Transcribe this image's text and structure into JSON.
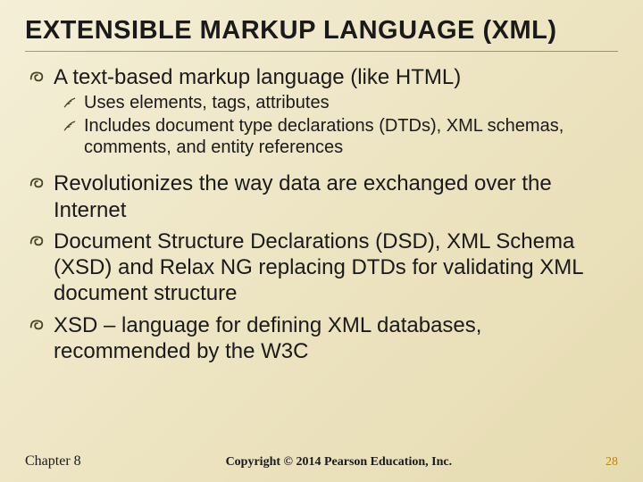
{
  "title": "EXTENSIBLE MARKUP LANGUAGE (XML)",
  "bullets": {
    "b1": "A text-based markup language (like HTML)",
    "b1_sub1": "Uses elements, tags, attributes",
    "b1_sub2": "Includes document type declarations (DTDs), XML schemas, comments, and entity references",
    "b2": "Revolutionizes the way data are exchanged over the Internet",
    "b3": "Document Structure Declarations (DSD), XML Schema (XSD) and Relax NG replacing DTDs for validating XML document structure",
    "b4": "XSD – language for defining XML databases, recommended by the W3C"
  },
  "footer": {
    "chapter": "Chapter 8",
    "copyright": "Copyright © 2014 Pearson Education, Inc.",
    "page": "28"
  }
}
